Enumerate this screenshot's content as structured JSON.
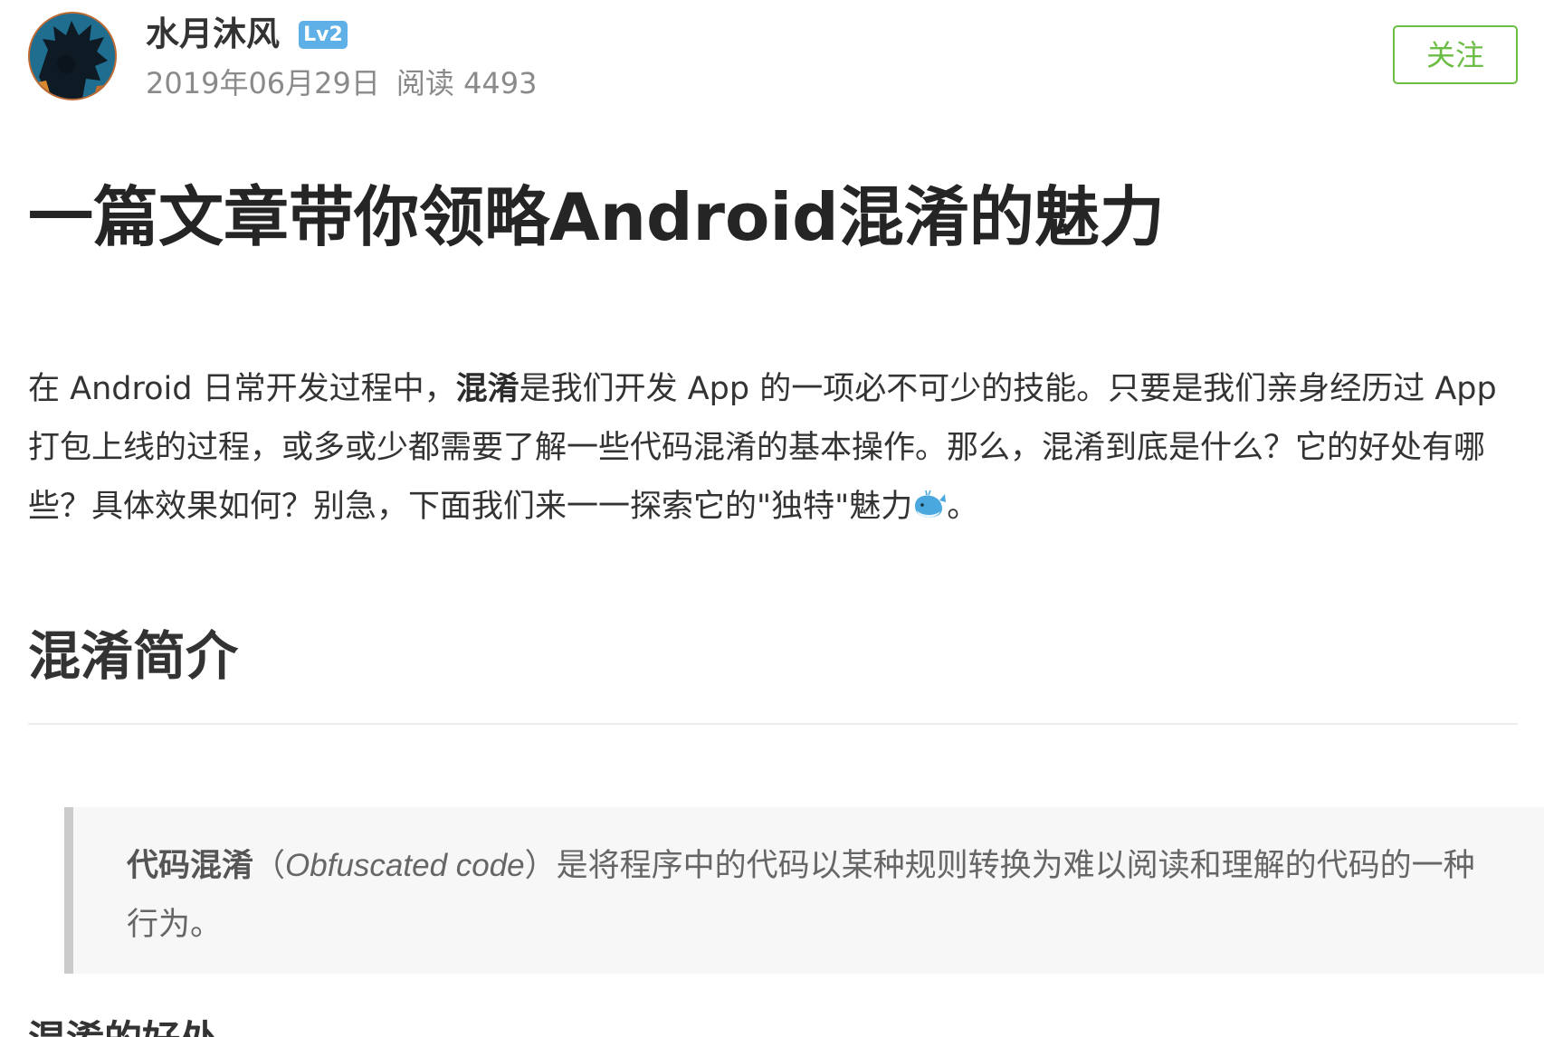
{
  "author": {
    "name": "水月沐风",
    "level": "Lv2",
    "date": "2019年06月29日",
    "reads": "阅读 4493",
    "follow_label": "关注"
  },
  "article": {
    "title": "一篇文章带你领略Android混淆的魅力",
    "intro": {
      "part1": "在 Android 日常开发过程中，",
      "bold": "混淆",
      "part2": "是我们开发 App 的一项必不可少的技能。只要是我们亲身经历过 App 打包上线的过程，或多或少都需要了解一些代码混淆的基本操作。那么，混淆到底是什么？它的好处有哪些？具体效果如何？别急，下面我们来一一探索它的\"独特\"魅力",
      "end": "。"
    },
    "section1_heading": "混淆简介",
    "quote": {
      "bold": "代码混淆",
      "open": "（",
      "italic": "Obfuscated code",
      "close": "）",
      "rest": "是将程序中的代码以某种规则转换为难以阅读和理解的代码的一种行为。"
    },
    "section2_heading": "混淆的好处"
  },
  "icons": {
    "avatar": "avatar-image",
    "emoji": "whale-icon"
  },
  "colors": {
    "follow_green": "#6cbd45",
    "badge_blue": "#5fb0e6"
  }
}
